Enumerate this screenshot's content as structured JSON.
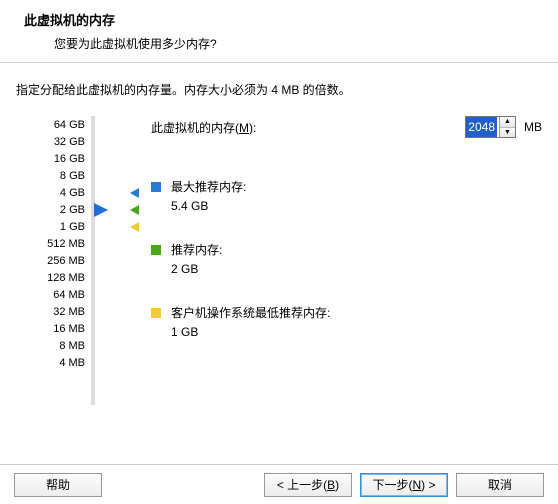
{
  "header": {
    "title": "此虚拟机的内存",
    "subtitle": "您要为此虚拟机使用多少内存?"
  },
  "desc": "指定分配给此虚拟机的内存量。内存大小必须为 4 MB 的倍数。",
  "mem_input": {
    "label_prefix": "此虚拟机的内存(",
    "label_key": "M",
    "label_suffix": "):",
    "value": "2048",
    "unit": "MB"
  },
  "scale": [
    "64 GB",
    "32 GB",
    "16 GB",
    "8 GB",
    "4 GB",
    "2 GB",
    "1 GB",
    "512 MB",
    "256 MB",
    "128 MB",
    "64 MB",
    "32 MB",
    "16 MB",
    "8 MB",
    "4 MB"
  ],
  "current_index": 5,
  "markers": {
    "max": {
      "index": 4,
      "color": "#2a7bd4"
    },
    "rec": {
      "index": 5,
      "color": "#4aa61b"
    },
    "min": {
      "index": 6,
      "color": "#f0c93e"
    }
  },
  "legends": {
    "max": {
      "label": "最大推荐内存:",
      "value": "5.4 GB"
    },
    "rec": {
      "label": "推荐内存:",
      "value": "2 GB"
    },
    "min": {
      "label": "客户机操作系统最低推荐内存:",
      "value": "1 GB"
    }
  },
  "buttons": {
    "help": "帮助",
    "back_pre": "< 上一步(",
    "back_key": "B",
    "back_suf": ")",
    "next_pre": "下一步(",
    "next_key": "N",
    "next_suf": ") >",
    "cancel": "取消"
  }
}
